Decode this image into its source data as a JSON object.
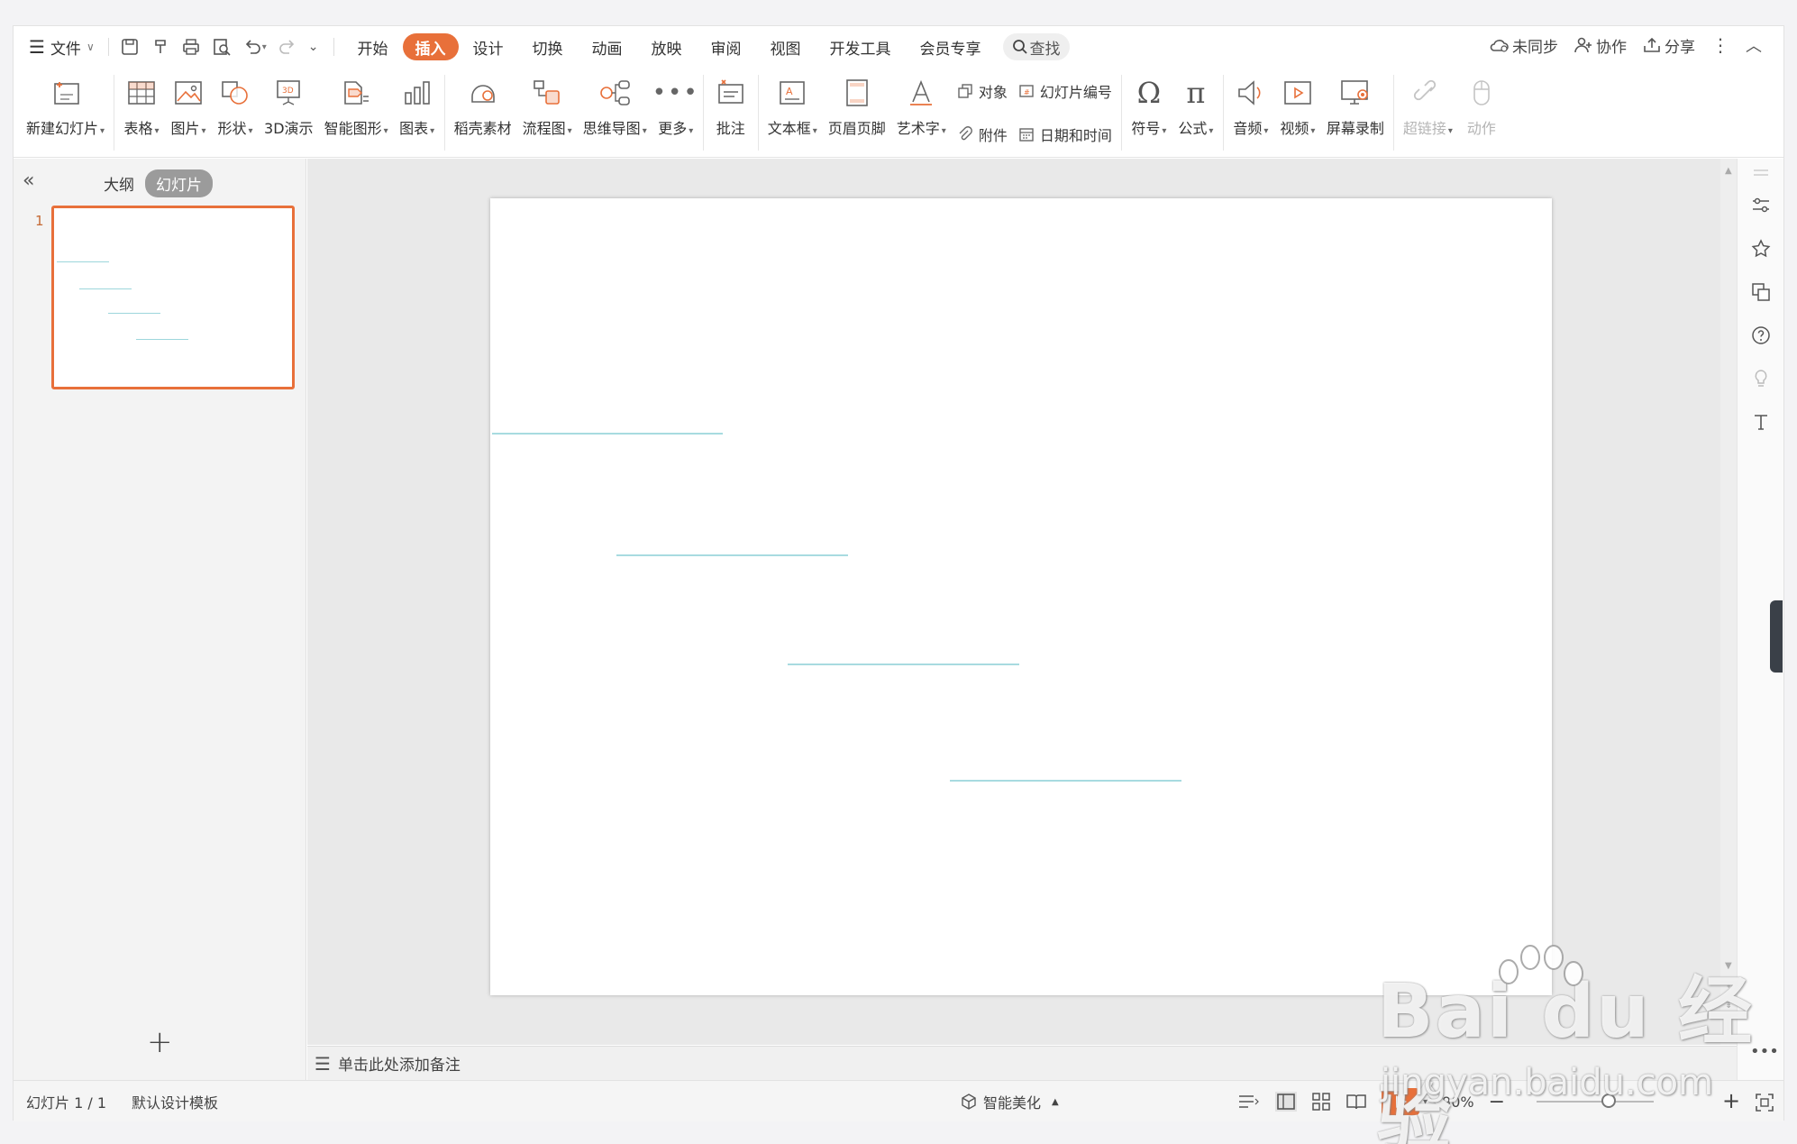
{
  "menu": {
    "file_label": "文件",
    "tabs": [
      "开始",
      "插入",
      "设计",
      "切换",
      "动画",
      "放映",
      "审阅",
      "视图",
      "开发工具",
      "会员专享"
    ],
    "active_tab": "插入",
    "search_label": "查找",
    "right": {
      "sync": "未同步",
      "collab": "协作",
      "share": "分享"
    }
  },
  "ribbon": {
    "new_slide": "新建幻灯片",
    "table": "表格",
    "picture": "图片",
    "shape": "形状",
    "demo3d": "3D演示",
    "smartart": "智能图形",
    "chart": "图表",
    "docer": "稻壳素材",
    "flowchart": "流程图",
    "mindmap": "思维导图",
    "more": "更多",
    "comment": "批注",
    "textbox": "文本框",
    "header_footer": "页眉页脚",
    "wordart": "艺术字",
    "object": "对象",
    "attachment": "附件",
    "slide_number": "幻灯片编号",
    "datetime": "日期和时间",
    "symbol": "符号",
    "equation": "公式",
    "audio": "音频",
    "video": "视频",
    "screen_record": "屏幕录制",
    "hyperlink": "超链接",
    "action": "动作"
  },
  "panel": {
    "outline_tab": "大纲",
    "slides_tab": "幻灯片",
    "slide_number": "1"
  },
  "notes": {
    "placeholder": "单击此处添加备注"
  },
  "status": {
    "slide_counter": "幻灯片 1 / 1",
    "template": "默认设计模板",
    "beautify": "智能美化",
    "zoom": "90%"
  },
  "watermark": {
    "brand": "Bai du 经验",
    "url": "jingyan.baidu.com"
  },
  "colors": {
    "accent": "#e8703a",
    "line": "#a8dbe0"
  }
}
